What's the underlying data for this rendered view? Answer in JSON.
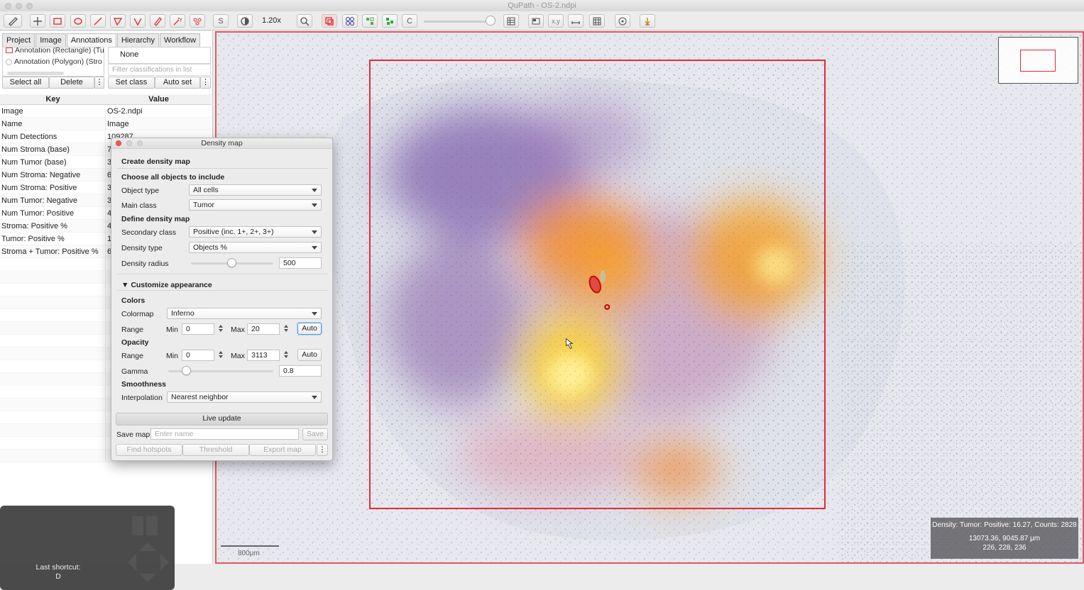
{
  "window": {
    "title": "QuPath - OS-2.ndpi"
  },
  "toolbar": {
    "zoom": "1.20x",
    "S_label": "S",
    "C_label": "C"
  },
  "left_panel": {
    "tabs": [
      "Project",
      "Image",
      "Annotations",
      "Hierarchy",
      "Workflow"
    ],
    "annotations": [
      "Annotation (Rectangle) (Tu",
      "Annotation (Polygon) (Stro"
    ],
    "class_selected": "None",
    "class_filter_placeholder": "Filter classifications in list",
    "buttons": {
      "select_all": "Select all",
      "delete": "Delete",
      "set_class": "Set class",
      "auto_set": "Auto set"
    },
    "table_headers": {
      "key": "Key",
      "value": "Value"
    },
    "rows": [
      {
        "key": "Image",
        "value": "OS-2.ndpi"
      },
      {
        "key": "Name",
        "value": "Image"
      },
      {
        "key": "Num Detections",
        "value": "109287"
      },
      {
        "key": "Num Stroma (base)",
        "value": "7"
      },
      {
        "key": "Num Tumor (base)",
        "value": "3"
      },
      {
        "key": "Num Stroma: Negative",
        "value": "6"
      },
      {
        "key": "Num Stroma: Positive",
        "value": "3"
      },
      {
        "key": "Num Tumor: Negative",
        "value": "3"
      },
      {
        "key": "Num Tumor: Positive",
        "value": "4"
      },
      {
        "key": "Stroma: Positive %",
        "value": "4"
      },
      {
        "key": "Tumor: Positive %",
        "value": "1"
      },
      {
        "key": "Stroma + Tumor: Positive %",
        "value": "6"
      }
    ]
  },
  "shortcut": {
    "label": "Last shortcut:",
    "key": "D"
  },
  "dialog": {
    "title": "Density map",
    "create_heading": "Create density map",
    "choose_heading": "Choose all objects to include",
    "object_type_label": "Object type",
    "object_type_value": "All cells",
    "main_class_label": "Main class",
    "main_class_value": "Tumor",
    "define_heading": "Define density map",
    "secondary_class_label": "Secondary class",
    "secondary_class_value": "Positive (inc. 1+, 2+, 3+)",
    "density_type_label": "Density type",
    "density_type_value": "Objects %",
    "density_radius_label": "Density radius",
    "density_radius_value": "500",
    "customize_heading": "Customize appearance",
    "colors_heading": "Colors",
    "colormap_label": "Colormap",
    "colormap_value": "Inferno",
    "range_label": "Range",
    "min_label": "Min",
    "max_label": "Max",
    "color_min": "0",
    "color_max": "20",
    "auto_label": "Auto",
    "opacity_heading": "Opacity",
    "opacity_min": "0",
    "opacity_max": "3113",
    "gamma_label": "Gamma",
    "gamma_value": "0.8",
    "smoothness_heading": "Smoothness",
    "interpolation_label": "Interpolation",
    "interpolation_value": "Nearest neighbor",
    "live_update": "Live update",
    "save_map_label": "Save map",
    "save_name_placeholder": "Enter name",
    "save": "Save",
    "find_hotspots": "Find hotspots",
    "threshold": "Threshold",
    "export_map": "Export map"
  },
  "viewer": {
    "info_line1": "Density: Tumor: Positive: 16.27, Counts: 2828",
    "info_line2": "13073.36, 9045.87 μm",
    "info_line3": "226, 228, 236",
    "scalebar": "800μm"
  },
  "colors": {
    "roi": "#e02b38",
    "viewer_border": "#e05a64",
    "focus": "#5c9be3"
  }
}
